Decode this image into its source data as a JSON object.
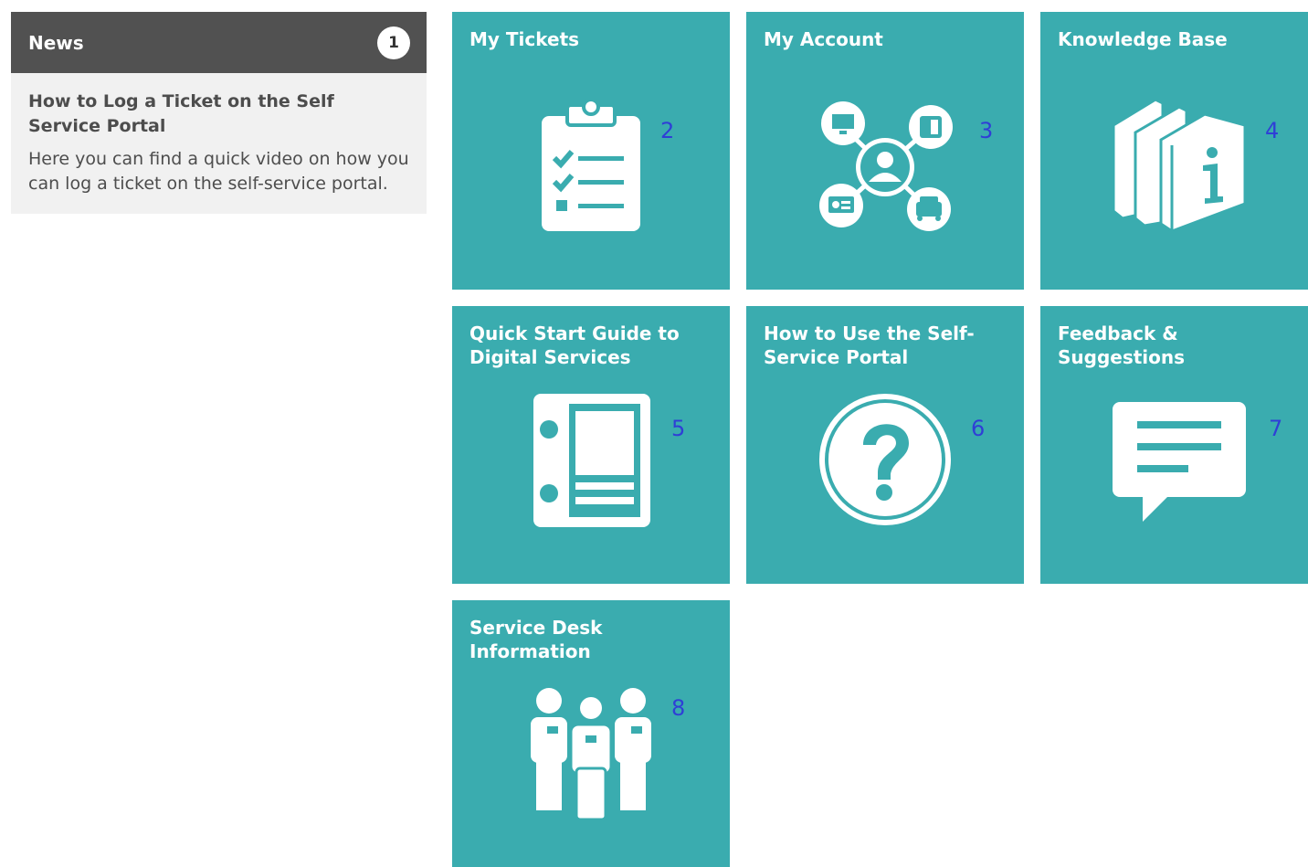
{
  "news": {
    "header": "News",
    "badge": "1",
    "item_title": "How to Log a Ticket on the Self Service Portal",
    "item_text": "Here you can find a quick video on how you can log a ticket on the self-service portal."
  },
  "tiles": [
    {
      "title": "My Tickets",
      "number": "2",
      "icon": "clipboard-checklist-icon"
    },
    {
      "title": "My Account",
      "number": "3",
      "icon": "account-network-icon"
    },
    {
      "title": "Knowledge Base",
      "number": "4",
      "icon": "books-info-icon"
    },
    {
      "title": "Quick Start Guide to Digital Services",
      "number": "5",
      "icon": "binder-guide-icon"
    },
    {
      "title": "How to Use the Self-Service Portal",
      "number": "6",
      "icon": "question-circle-icon"
    },
    {
      "title": "Feedback & Suggestions",
      "number": "7",
      "icon": "speech-bubble-icon"
    },
    {
      "title": "Service Desk Information",
      "number": "8",
      "icon": "team-people-icon"
    }
  ],
  "colors": {
    "tile": "#3aacaf",
    "news_header": "#515151",
    "news_body": "#f1f1f1",
    "number_label": "#2f3fd6"
  }
}
